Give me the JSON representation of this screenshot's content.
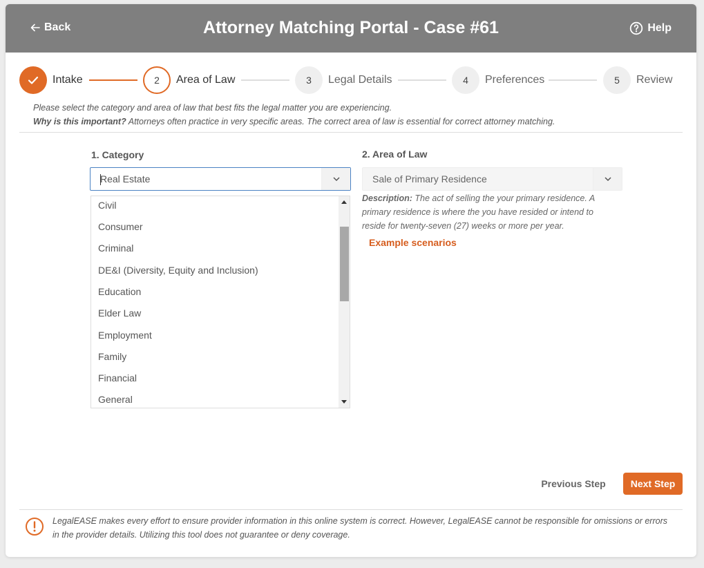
{
  "header": {
    "back_label": "Back",
    "title": "Attorney Matching Portal - Case #61",
    "help_label": "Help",
    "background": "#7f7f7f"
  },
  "stepper": {
    "accent": "#e06a26",
    "steps": [
      {
        "number": "",
        "label": "Intake",
        "state": "done"
      },
      {
        "number": "2",
        "label": "Area of Law",
        "state": "active"
      },
      {
        "number": "3",
        "label": "Legal Details",
        "state": "pending"
      },
      {
        "number": "4",
        "label": "Preferences",
        "state": "pending"
      },
      {
        "number": "5",
        "label": "Review",
        "state": "pending"
      }
    ]
  },
  "intro": {
    "line1": "Please select the category and area of law that best fits the legal matter you are experiencing.",
    "why_label": "Why is this important?",
    "why_text": " Attorneys often practice in very specific areas. The correct area of law is essential for correct attorney matching."
  },
  "category": {
    "label": "1. Category",
    "value": "Real Estate",
    "options": [
      "Civil",
      "Consumer",
      "Criminal",
      "DE&I (Diversity, Equity and Inclusion)",
      "Education",
      "Elder Law",
      "Employment",
      "Family",
      "Financial",
      "General"
    ]
  },
  "area_of_law": {
    "label": "2. Area of Law",
    "value": "Sale of Primary Residence",
    "description_label": "Description:",
    "description_text": " The act of selling the your primary residence. A primary residence is where the you have resided or intend to reside for twenty-seven (27) weeks or more per year.",
    "example_link": "Example scenarios"
  },
  "nav": {
    "previous_label": "Previous Step",
    "next_label": "Next Step"
  },
  "disclaimer": {
    "text": "LegalEASE makes every effort to ensure provider information in this online system is correct. However, LegalEASE cannot be responsible for omissions or errors in the provider details. Utilizing this tool does not guarantee or deny coverage.",
    "icon": "warning-circle-icon",
    "color": "#e06a26"
  }
}
